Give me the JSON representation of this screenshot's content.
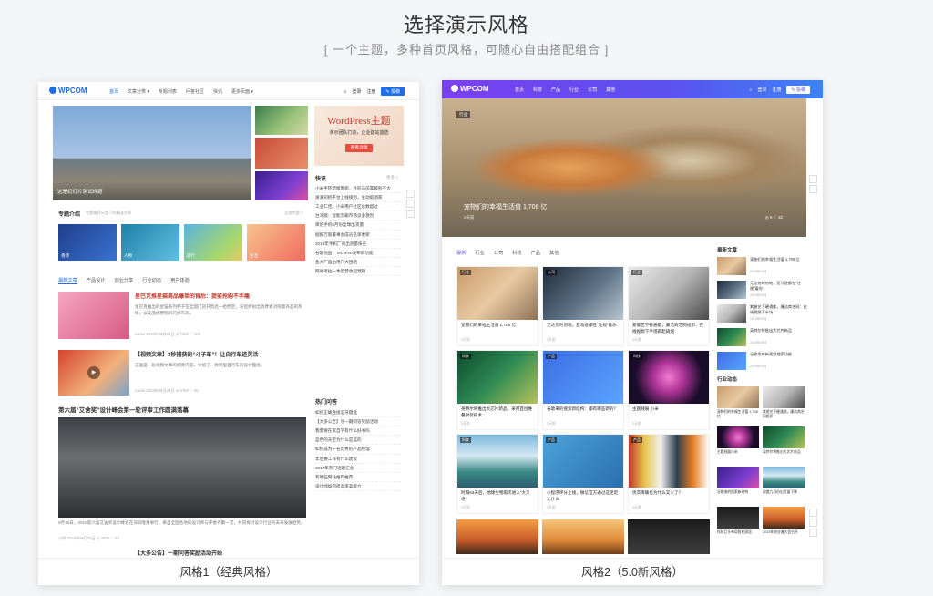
{
  "header": {
    "title": "选择演示风格",
    "subtitle": "[ 一个主题，多种首页风格，可随心自由搭配组合 ]"
  },
  "style1": {
    "caption": "风格1（经典风格）",
    "logo": "WPCOM",
    "nav": [
      "首页",
      "文章分类 ▾",
      "专题列表",
      "问答社区",
      "快讯",
      "更多页面 ▾"
    ],
    "login": "登录",
    "register": "注册",
    "publish": "✎ 投稿",
    "hero_caption": "这是幻灯片测试标题",
    "ad_title": "WordPress主题",
    "ad_sub": "演示团队打造，企业建站首选",
    "ad_button": "查看详情",
    "side_title": "快讯",
    "side_more": "更多 >",
    "side_items": [
      "小米手环新版面貌，外形与前辈差别不大",
      "滴滴司机平台上线规则，主动取消率",
      "工业仁佳，小米用户社区总数超过",
      "台湾版：智能音箱市场竞争激烈",
      "库伦手机5月份全球出货量",
      "据报万丽董事会成员名单更新",
      "2018年手机厂商出货量排名",
      "谷歌地图：TechFire发布新功能",
      "鱼大厂自由用户大团结",
      "网易考拉一季度营收超预期"
    ],
    "topic_title": "专题介绍",
    "topic_desc": "专题推荐分类下的精选文章",
    "topic_more": "全部专题 >",
    "topic_labels": [
      "香港",
      "人物",
      "旅行",
      "生活"
    ],
    "tabs": [
      "最新文章",
      "产品设计",
      "创业分享",
      "行业动态",
      "用户体验"
    ],
    "post1_title": "星巴克推星猫商品爆单的背后：提前抢购不手痛",
    "post1_excerpt": "星巴克推出的星猫系列杯子在全国门店开售后一抢而空，背后折射出消费者对限量商品的热情，以及品牌营销的巧妙布局。",
    "post1_meta": "Lucas   2019年08月28日   ◎ 7456   ♡ 105",
    "post2_title": "【视频文章】3秒捕获的“斗子车”！让自行车还灵活",
    "post2_excerpt": "这里是一段视频文章的摘要内容，介绍了一款新型自行车的设计理念。",
    "post2_meta": "Lucas   2019年08月26日   ◎ 6768   ♡ 88",
    "post3_title": "第六届“艾舍奖”设计峰会第一轮评审工作圆满落幕",
    "post3_excerpt": "9月16日，2018第六届艾舍奖设计峰会在深圳隆重举行，来自全国各地的设计师与评委齐聚一堂，共同探讨设计行业的未来发展趋势。",
    "post3_meta": "小明   2019年09月26日   ◎ 3895   ♡ 69",
    "hot_title": "热门问答",
    "hot_items": [
      "如何正确连接蓝牙键盘",
      "【大多公告】领一期问答奖励活动",
      "我需要在家自学有什么好书吗",
      "蓝色的天空为什么是蓝的",
      "如何成为一名优秀的产品经理",
      "年后换工作有什么建议",
      "2017年热门话题汇总",
      "有哪些网站推荐推荐",
      "设计师如何提高审美能力"
    ],
    "next_post": "【大多公告】一期问答奖励活动开始"
  },
  "style2": {
    "caption": "风格2（5.0新风格）",
    "logo": "WPCOM",
    "nav": [
      "首页",
      "科技",
      "产品",
      "行业",
      "公司",
      "其他"
    ],
    "login": "登录",
    "register": "注册",
    "publish": "✎ 投稿",
    "hero_tag": "行业",
    "hero_title": "宠物们的幸福生活值 1,708 亿",
    "hero_meta": "2天前",
    "hero_stats": "◎ 6   ♡ 32",
    "tabs": [
      "最新",
      "行业",
      "公司",
      "科技",
      "产品",
      "其他"
    ],
    "tiles": [
      {
        "tag": "行业",
        "title": "宠物们的幸福生活值 1,708 亿",
        "meta": "2天前"
      },
      {
        "tag": "公司",
        "title": "无论何时何地，亚马逊都在“注视”着你",
        "meta": "2天前"
      },
      {
        "tag": "行业",
        "title": "紫誉艺下硬通都，廉洁商艺网组织：在线视频下半场再起硝烟",
        "meta": "2天前"
      },
      {
        "tag": "科技",
        "title": "英特尔将推出大芯片新品，采用首创堆叠封装技术",
        "meta": "2天前"
      },
      {
        "tag": "产品",
        "title": "谷歌来的搜索新结构：都有哪些新的？",
        "meta": "2天前"
      },
      {
        "tag": "科技",
        "title": "主题线展 小米",
        "meta": "2天前"
      },
      {
        "tag": "科技",
        "title": "时隔63天后，地球生物再次进入“大灭绝”",
        "meta": "2天前"
      },
      {
        "tag": "产品",
        "title": "小程序评分上线，微信官方通过这足足让什么",
        "meta": "2天前"
      },
      {
        "tag": "产品",
        "title": "优衣库联名为什么又火了？",
        "meta": "2天前"
      }
    ],
    "side_title1": "最新文章",
    "side_items": [
      {
        "title": "宠物们的幸福生活值 1,708 亿",
        "meta": "2019年09月"
      },
      {
        "title": "无论何时何地，亚马逊都在“注视”着你",
        "meta": "2019年09月"
      },
      {
        "title": "紫誉艺下硬通都，廉洁商艺网：在线视频下半场",
        "meta": "2019年09月"
      },
      {
        "title": "英特尔将推出大芯片新品",
        "meta": "2019年09月"
      },
      {
        "title": "谷歌发布新视频搜索功能",
        "meta": "2019年09月"
      }
    ],
    "side_title2": "行业动态",
    "grid_items": [
      "宠物们的幸福生活值 1,708 亿",
      "紫誉艺下硬通都，廉洁商艺网组织",
      "主题线展小米",
      "英特尔将推出大芯片新品",
      "谷歌来的搜索新结构",
      "印度九月份出货量下降",
      "科技巨头布局智能家居",
      "2019年创业者大会召开"
    ]
  }
}
